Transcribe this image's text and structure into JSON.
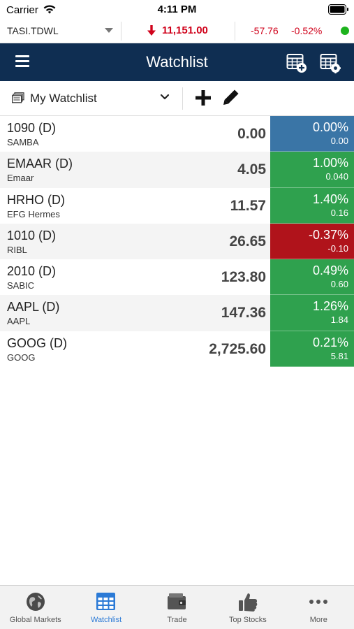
{
  "status_bar": {
    "carrier": "Carrier",
    "time": "4:11 PM"
  },
  "index_ticker": {
    "symbol": "TASI.TDWL",
    "value": "11,151.00",
    "direction": "down",
    "change": "-57.76",
    "change_pct": "-0.52%",
    "status_color": "#1db31d"
  },
  "nav": {
    "title": "Watchlist"
  },
  "selector": {
    "watchlist_name": "My Watchlist"
  },
  "colors": {
    "neutral": "#3a75a6",
    "up": "#2fa14e",
    "down": "#b0131b",
    "nav_bg": "#0f2e52",
    "tab_active": "#2b7ad6"
  },
  "rows": [
    {
      "symbol": "1090 (D)",
      "name": "SAMBA",
      "price": "0.00",
      "pct": "0.00%",
      "abs": "0.00",
      "trend": "neutral"
    },
    {
      "symbol": "EMAAR (D)",
      "name": "Emaar",
      "price": "4.05",
      "pct": "1.00%",
      "abs": "0.040",
      "trend": "up"
    },
    {
      "symbol": "HRHO (D)",
      "name": "EFG Hermes",
      "price": "11.57",
      "pct": "1.40%",
      "abs": "0.16",
      "trend": "up"
    },
    {
      "symbol": "1010 (D)",
      "name": "RIBL",
      "price": "26.65",
      "pct": "-0.37%",
      "abs": "-0.10",
      "trend": "down"
    },
    {
      "symbol": "2010 (D)",
      "name": "SABIC",
      "price": "123.80",
      "pct": "0.49%",
      "abs": "0.60",
      "trend": "up"
    },
    {
      "symbol": "AAPL (D)",
      "name": "AAPL",
      "price": "147.36",
      "pct": "1.26%",
      "abs": "1.84",
      "trend": "up"
    },
    {
      "symbol": "GOOG (D)",
      "name": "GOOG",
      "price": "2,725.60",
      "pct": "0.21%",
      "abs": "5.81",
      "trend": "up"
    }
  ],
  "tabs": [
    {
      "label": "Global Markets",
      "icon": "globe-icon",
      "active": false
    },
    {
      "label": "Watchlist",
      "icon": "watchlist-grid-icon",
      "active": true
    },
    {
      "label": "Trade",
      "icon": "wallet-icon",
      "active": false
    },
    {
      "label": "Top Stocks",
      "icon": "thumbs-up-icon",
      "active": false
    },
    {
      "label": "More",
      "icon": "more-dots-icon",
      "active": false
    }
  ]
}
